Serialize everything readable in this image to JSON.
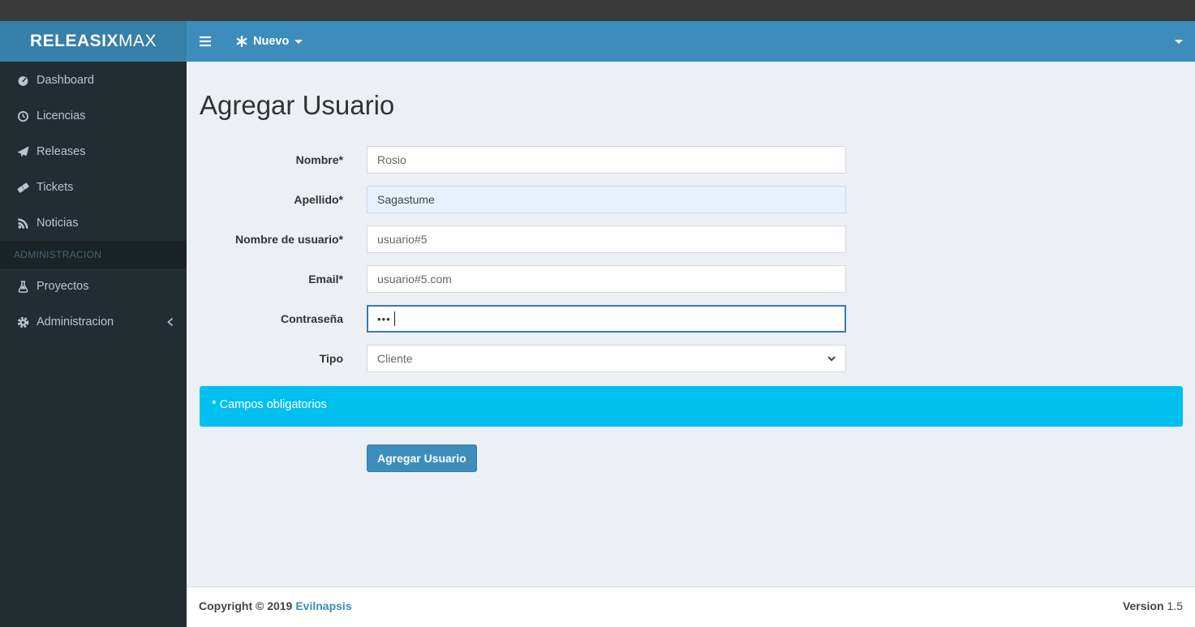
{
  "colors": {
    "navbar": "#3c8dbc",
    "logo_bg": "#367fa9",
    "sidebar_bg": "#222d32",
    "info_bar": "#00c0ef",
    "content_bg": "#ecf0f5",
    "top_strip": "#3a3a3a"
  },
  "header": {
    "logo_bold": "RELEASIX",
    "logo_light": "MAX",
    "nuevo_label": "Nuevo"
  },
  "sidebar": {
    "items": [
      {
        "label": "Dashboard",
        "icon": "tachometer-icon"
      },
      {
        "label": "Licencias",
        "icon": "clock-icon"
      },
      {
        "label": "Releases",
        "icon": "paper-plane-icon"
      },
      {
        "label": "Tickets",
        "icon": "ticket-icon"
      },
      {
        "label": "Noticias",
        "icon": "rss-icon"
      }
    ],
    "section_header": "ADMINISTRACION",
    "admin_items": [
      {
        "label": "Proyectos",
        "icon": "flask-icon"
      },
      {
        "label": "Administracion",
        "icon": "gear-icon",
        "has_submenu": true
      }
    ]
  },
  "main": {
    "title": "Agregar Usuario",
    "form": {
      "fields": [
        {
          "label": "Nombre*",
          "value": "Rosio",
          "type": "text"
        },
        {
          "label": "Apellido*",
          "value": "Sagastume",
          "type": "text"
        },
        {
          "label": "Nombre de usuario*",
          "value": "usuario#5",
          "type": "text"
        },
        {
          "label": "Email*",
          "value": "usuario#5.com",
          "type": "text"
        },
        {
          "label": "Contraseña",
          "value": "•••",
          "type": "password"
        },
        {
          "label": "Tipo",
          "value": "Cliente",
          "type": "select"
        }
      ],
      "note": "* Campos obligatorios",
      "submit_label": "Agregar Usuario"
    }
  },
  "footer": {
    "copyright_prefix": "Copyright © 2019",
    "copyright_link": "Evilnapsis",
    "version_label": "Version",
    "version_value": "1.5"
  }
}
